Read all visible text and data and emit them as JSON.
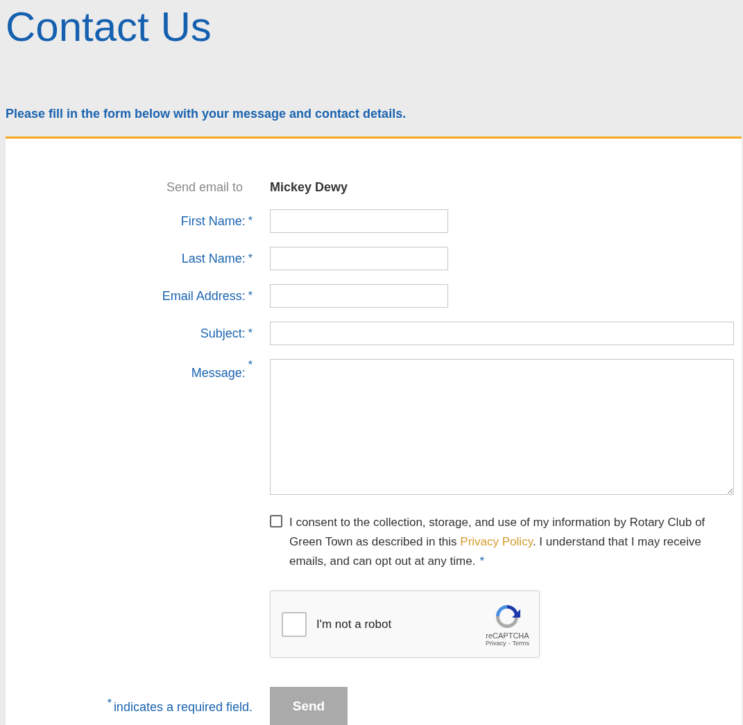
{
  "title": "Contact Us",
  "intro": "Please fill in the form below with your message and contact details.",
  "required_mark": "*",
  "recipient": {
    "label": "Send email to",
    "value": "Mickey Dewy"
  },
  "fields": [
    {
      "label": "First Name:",
      "kind": "input",
      "required": true
    },
    {
      "label": "Last Name:",
      "kind": "input",
      "required": true
    },
    {
      "label": "Email Address:",
      "kind": "input",
      "required": true
    },
    {
      "label": "Subject:",
      "kind": "wideinput",
      "required": true
    },
    {
      "label": "Message:",
      "kind": "textarea",
      "required": true
    }
  ],
  "consent": {
    "checked": false,
    "before": "I consent to the collection, storage, and use of my information by Rotary Club of Green Town as described in this ",
    "link": "Privacy Policy",
    "after": ". I understand that I may receive emails, and can opt out at any time.",
    "required": true
  },
  "captcha": {
    "label": "I'm not a robot",
    "checked": false,
    "brand": "reCAPTCHA",
    "privacy": "Privacy",
    "separator": "-",
    "terms": "Terms"
  },
  "required_note": "indicates a required field.",
  "send_button": {
    "label": "Send",
    "disabled": true
  }
}
